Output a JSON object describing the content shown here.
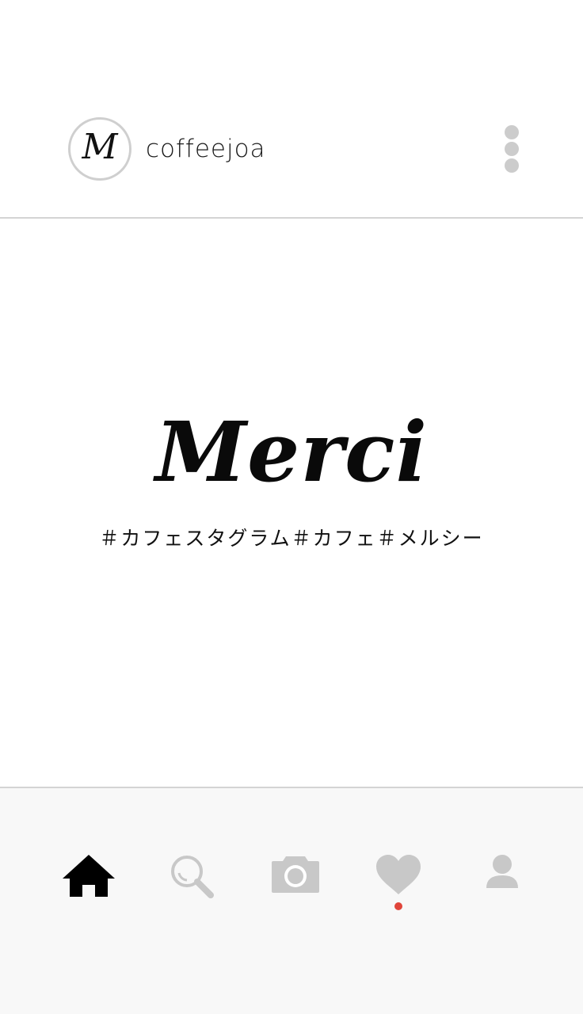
{
  "header": {
    "avatar_letter": "M",
    "username": "coffeejoa"
  },
  "post": {
    "brand": "Merci",
    "hashtags": "＃カフェスタグラム＃カフェ＃メルシー"
  },
  "tabbar": {
    "items": [
      {
        "icon": "home-icon",
        "active": true
      },
      {
        "icon": "search-icon",
        "active": false
      },
      {
        "icon": "camera-icon",
        "active": false
      },
      {
        "icon": "heart-icon",
        "active": false,
        "notification": true
      },
      {
        "icon": "profile-icon",
        "active": false
      }
    ]
  },
  "colors": {
    "active_icon": "#000000",
    "inactive_icon": "#c8c8c8",
    "notification_dot": "#e0453a",
    "divider": "#d4d4d4",
    "tabbar_background": "#f8f8f8"
  }
}
